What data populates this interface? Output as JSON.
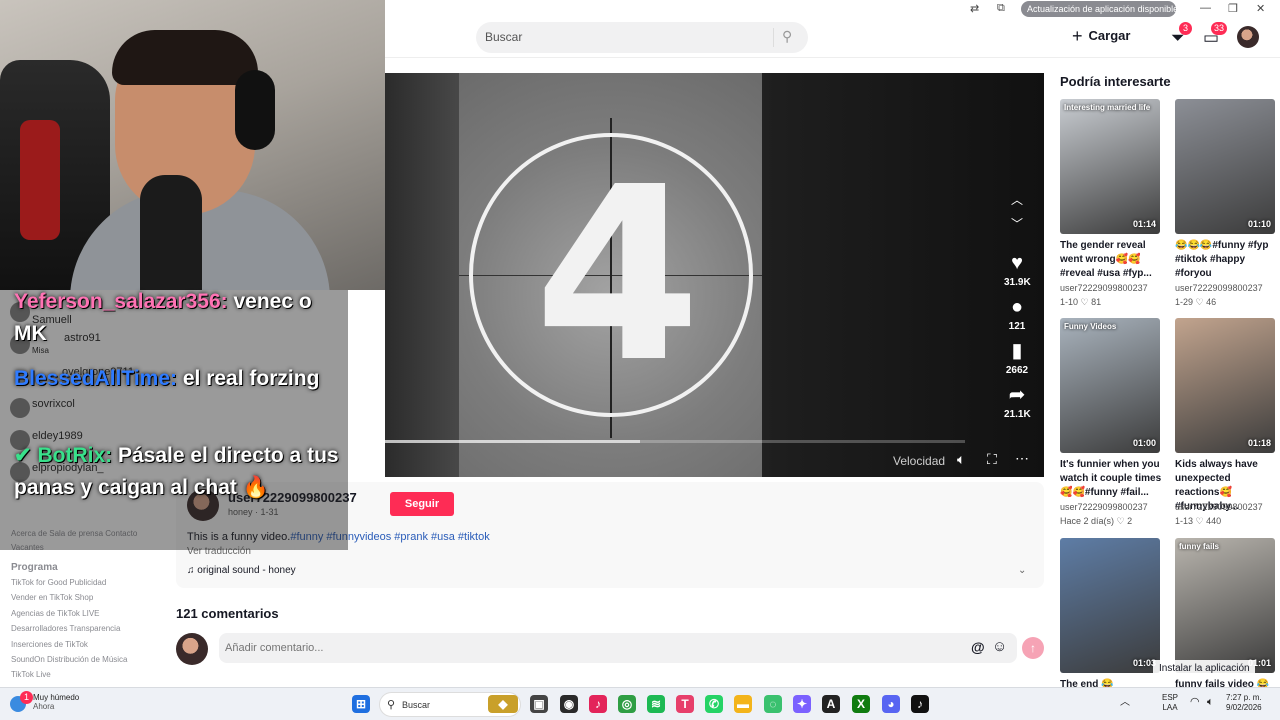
{
  "topbar": {
    "search_placeholder": "Buscar",
    "update_pill": "Actualización de aplicación disponible",
    "upload_label": "Cargar",
    "inbox_badge": "3",
    "messages_badge": "33"
  },
  "video": {
    "countdown_digit": "4",
    "speed_label": "Velocidad",
    "progress": 0.44,
    "actions": {
      "likes": "31.9K",
      "comments": "121",
      "saves": "2662",
      "shares": "21.1K"
    }
  },
  "chat": {
    "messages": [
      {
        "user": "Yeferson_salazar356:",
        "text": "venec o MK"
      },
      {
        "user": "BlessedAllTime:",
        "text": "el real forzing"
      },
      {
        "user": "BotRix:",
        "text": "Pásale el directo a tus panas y caigan al chat 🔥"
      }
    ],
    "ghost_users": [
      "Samuell",
      "astro91",
      "Misa",
      "ovelgrone9711",
      "sovrixcol",
      "eldey1989",
      "elpropiodylan_"
    ]
  },
  "post": {
    "author": "user72229099800237",
    "author_sub": "honey · 1-31",
    "follow_label": "Seguir",
    "description": "This is a funny video.",
    "hashtags": "#funny #funnyvideos #prank #usa #tiktok",
    "translate_label": "Ver traducción",
    "sound": "♫ original sound - honey"
  },
  "comments": {
    "title": "121 comentarios",
    "input_placeholder": "Añadir comentario..."
  },
  "sidebar": {
    "top_links": "Acerca de  Sala de prensa  Contacto",
    "careers": "Vacantes",
    "program_heading": "Programa",
    "links": [
      "TikTok for Good  Publicidad",
      "Vender en TikTok Shop",
      "Agencias de TikTok LIVE",
      "Desarrolladores  Transparencia",
      "Inserciones de TikTok",
      "SoundOn Distribución de Música",
      "TikTok Live"
    ]
  },
  "recommended": {
    "title": "Podría interesarte",
    "install_label": "Instalar la aplicación",
    "cards": [
      {
        "overlay": "Interesting married life",
        "duration": "01:14",
        "title": "The gender reveal went wrong🥰🥰 #reveal #usa #fyp...",
        "user": "user72229099800237",
        "date": "1-10",
        "likes": "81",
        "color": "#c9cdd2"
      },
      {
        "overlay": "",
        "duration": "01:10",
        "title": "😂😂😂#funny #fyp #tiktok #happy #foryou",
        "user": "user72229099800237",
        "date": "1-29",
        "likes": "46",
        "color": "#8c8f96"
      },
      {
        "overlay": "Funny Videos",
        "duration": "01:00",
        "title": "It's funnier when you watch it couple times🥰🥰#funny #fail...",
        "user": "user72229099800237",
        "date": "Hace 2 día(s)",
        "likes": "2",
        "color": "#a9b3bd"
      },
      {
        "overlay": "",
        "duration": "01:18",
        "title": "Kids always have unexpected reactions🥰#funnybaby...",
        "user": "user72229099800237",
        "date": "1-13",
        "likes": "440",
        "color": "#c2a48e"
      },
      {
        "overlay": "",
        "duration": "01:03",
        "title": "The end 😂",
        "user": "",
        "date": "",
        "likes": "",
        "color": "#5e7da6"
      },
      {
        "overlay": "funny fails",
        "duration": "01:01",
        "title": "funny fails video 😂",
        "user": "",
        "date": "",
        "likes": "",
        "color": "#b9b5ae"
      }
    ]
  },
  "taskbar": {
    "weather_title": "Muy húmedo",
    "weather_sub": "Ahora",
    "search_label": "Buscar",
    "lang": "ESP",
    "lang_sub": "LAA",
    "time": "7:27 p. m.",
    "date": "9/02/2026",
    "weather_badge": "1"
  }
}
